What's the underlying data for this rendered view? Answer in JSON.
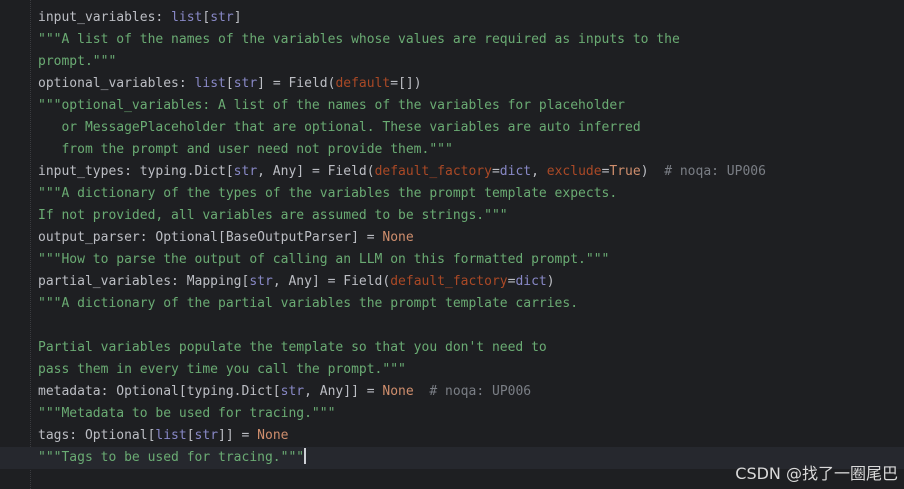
{
  "editor": {
    "lines": [
      [
        {
          "t": "input_variables: ",
          "c": "plain"
        },
        {
          "t": "list",
          "c": "builtin"
        },
        {
          "t": "[",
          "c": "plain"
        },
        {
          "t": "str",
          "c": "builtin"
        },
        {
          "t": "]",
          "c": "plain"
        }
      ],
      [
        {
          "t": "\"\"\"A list of the names of the variables whose values are required as inputs to the",
          "c": "string"
        }
      ],
      [
        {
          "t": "prompt.\"\"\"",
          "c": "string"
        }
      ],
      [
        {
          "t": "optional_variables: ",
          "c": "plain"
        },
        {
          "t": "list",
          "c": "builtin"
        },
        {
          "t": "[",
          "c": "plain"
        },
        {
          "t": "str",
          "c": "builtin"
        },
        {
          "t": "] = Field(",
          "c": "plain"
        },
        {
          "t": "default",
          "c": "kwarg"
        },
        {
          "t": "=[])",
          "c": "plain"
        }
      ],
      [
        {
          "t": "\"\"\"optional_variables: A list of the names of the variables for placeholder",
          "c": "string"
        }
      ],
      [
        {
          "t": "   or MessagePlaceholder that are optional. These variables are auto inferred",
          "c": "string"
        }
      ],
      [
        {
          "t": "   from the prompt and user need not provide them.\"\"\"",
          "c": "string"
        }
      ],
      [
        {
          "t": "input_types: typing.Dict[",
          "c": "plain"
        },
        {
          "t": "str",
          "c": "builtin"
        },
        {
          "t": ", Any] = Field(",
          "c": "plain"
        },
        {
          "t": "default_factory",
          "c": "kwarg"
        },
        {
          "t": "=",
          "c": "plain"
        },
        {
          "t": "dict",
          "c": "builtin"
        },
        {
          "t": ", ",
          "c": "plain"
        },
        {
          "t": "exclude",
          "c": "kwarg"
        },
        {
          "t": "=",
          "c": "plain"
        },
        {
          "t": "True",
          "c": "keyword"
        },
        {
          "t": ")  ",
          "c": "plain"
        },
        {
          "t": "# noqa: UP006",
          "c": "comment"
        }
      ],
      [
        {
          "t": "\"\"\"A dictionary of the types of the variables the prompt template expects.",
          "c": "string"
        }
      ],
      [
        {
          "t": "If not provided, all variables are assumed to be strings.\"\"\"",
          "c": "string"
        }
      ],
      [
        {
          "t": "output_parser: Optional[BaseOutputParser] = ",
          "c": "plain"
        },
        {
          "t": "None",
          "c": "keyword"
        }
      ],
      [
        {
          "t": "\"\"\"How to parse the output of calling an LLM on this formatted prompt.\"\"\"",
          "c": "string"
        }
      ],
      [
        {
          "t": "partial_variables: Mapping[",
          "c": "plain"
        },
        {
          "t": "str",
          "c": "builtin"
        },
        {
          "t": ", Any] = Field(",
          "c": "plain"
        },
        {
          "t": "default_factory",
          "c": "kwarg"
        },
        {
          "t": "=",
          "c": "plain"
        },
        {
          "t": "dict",
          "c": "builtin"
        },
        {
          "t": ")",
          "c": "plain"
        }
      ],
      [
        {
          "t": "\"\"\"A dictionary of the partial variables the prompt template carries.",
          "c": "string"
        }
      ],
      [
        {
          "t": "",
          "c": "plain"
        }
      ],
      [
        {
          "t": "Partial variables populate the template so that you don't need to",
          "c": "string"
        }
      ],
      [
        {
          "t": "pass them in every time you call the prompt.\"\"\"",
          "c": "string"
        }
      ],
      [
        {
          "t": "metadata: Optional[typing.Dict[",
          "c": "plain"
        },
        {
          "t": "str",
          "c": "builtin"
        },
        {
          "t": ", Any]] = ",
          "c": "plain"
        },
        {
          "t": "None",
          "c": "keyword"
        },
        {
          "t": "  ",
          "c": "plain"
        },
        {
          "t": "# noqa: UP006",
          "c": "comment"
        }
      ],
      [
        {
          "t": "\"\"\"Metadata to be used for tracing.\"\"\"",
          "c": "string"
        }
      ],
      [
        {
          "t": "tags: Optional[",
          "c": "plain"
        },
        {
          "t": "list",
          "c": "builtin"
        },
        {
          "t": "[",
          "c": "plain"
        },
        {
          "t": "str",
          "c": "builtin"
        },
        {
          "t": "]] = ",
          "c": "plain"
        },
        {
          "t": "None",
          "c": "keyword"
        }
      ],
      [
        {
          "t": "\"\"\"Tags to be used for tracing.\"\"\"",
          "c": "string"
        }
      ]
    ],
    "current_line": 20
  },
  "watermark": "CSDN @找了一圈尾巴"
}
